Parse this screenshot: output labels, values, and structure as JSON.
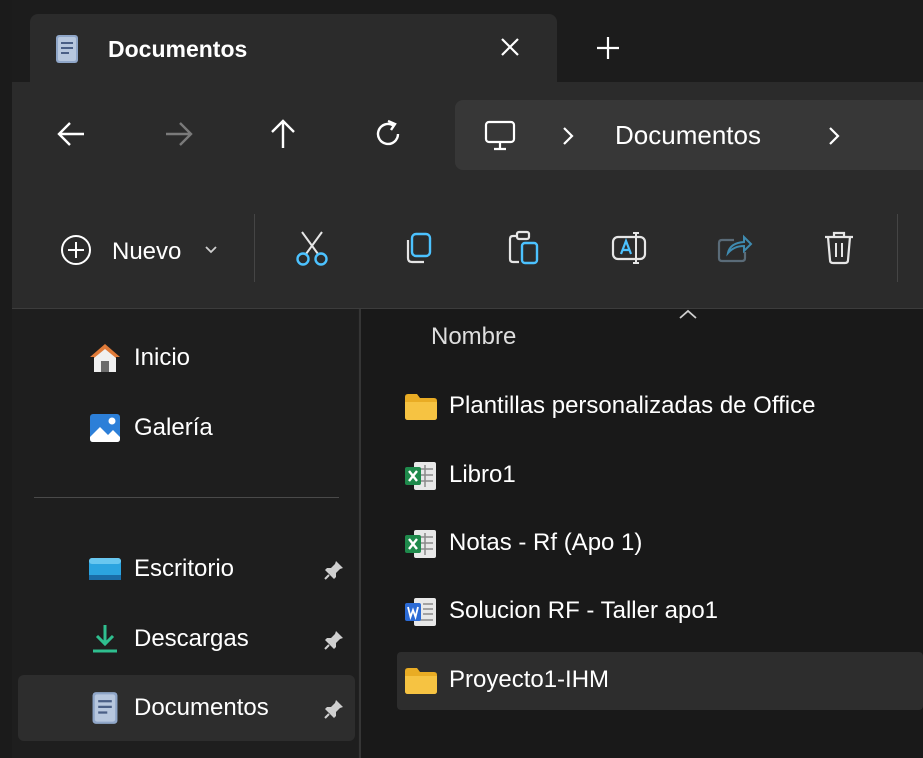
{
  "tab": {
    "title": "Documentos",
    "icon": "document-icon"
  },
  "navigation": {
    "back_icon": "arrow-left-icon",
    "forward_icon": "arrow-right-icon",
    "up_icon": "arrow-up-icon",
    "refresh_icon": "refresh-icon",
    "address": {
      "root_icon": "this-pc-icon",
      "crumbs": [
        "Documentos"
      ]
    }
  },
  "toolbar": {
    "new_label": "Nuevo",
    "actions": [
      "cut",
      "copy",
      "paste",
      "rename",
      "share",
      "delete"
    ]
  },
  "sidebar": {
    "items": [
      {
        "label": "Inicio",
        "icon": "home-icon"
      },
      {
        "label": "Galería",
        "icon": "gallery-icon"
      },
      {
        "label": "Escritorio",
        "icon": "desktop-icon",
        "pinned": true
      },
      {
        "label": "Descargas",
        "icon": "downloads-icon",
        "pinned": true
      },
      {
        "label": "Documentos",
        "icon": "documents-icon",
        "pinned": true,
        "selected": true
      }
    ]
  },
  "content": {
    "column_header": "Nombre",
    "files": [
      {
        "name": "Plantillas personalizadas de Office",
        "icon": "folder-icon"
      },
      {
        "name": "Libro1",
        "icon": "excel-icon"
      },
      {
        "name": "Notas - Rf (Apo 1)",
        "icon": "excel-icon"
      },
      {
        "name": "Solucion RF - Taller apo1",
        "icon": "word-icon"
      },
      {
        "name": "Proyecto1-IHM",
        "icon": "folder-icon",
        "selected": true
      }
    ]
  },
  "colors": {
    "accent": "#4cc2ff",
    "folder": "#f6c342",
    "excel": "#1f8a4c",
    "word": "#2b6bd6",
    "home": "#e07b39"
  }
}
